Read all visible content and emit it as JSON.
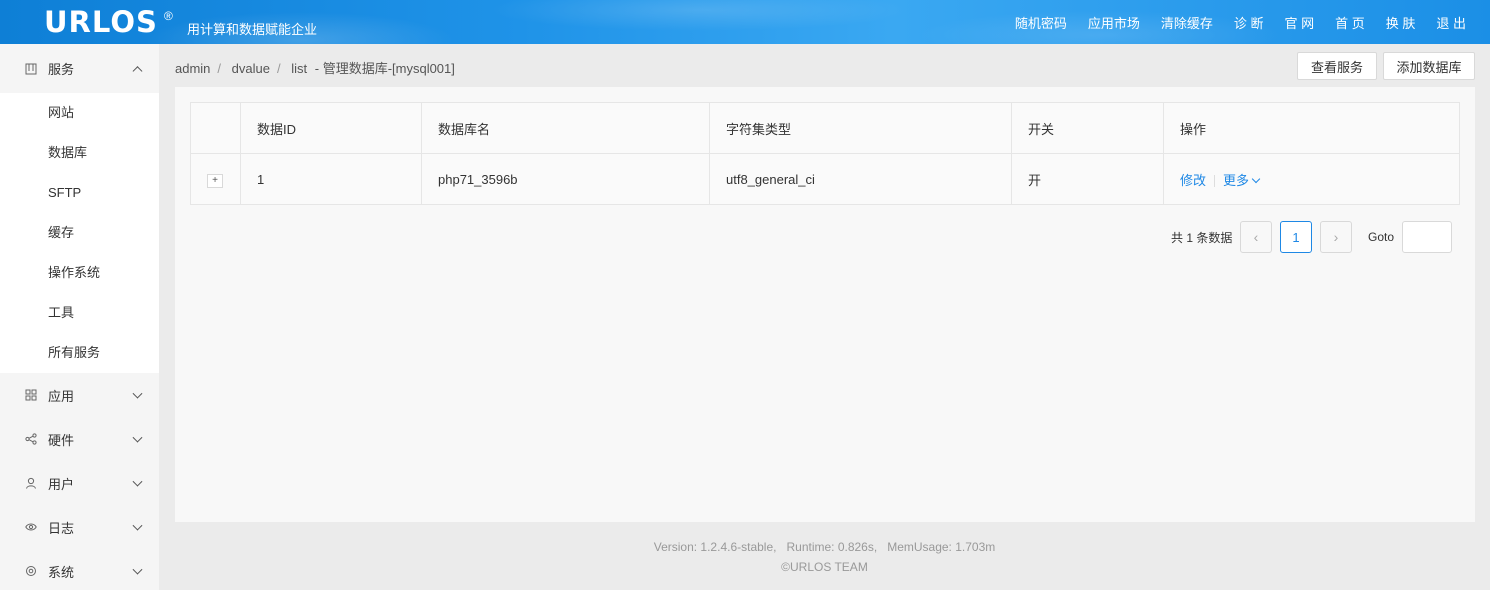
{
  "header": {
    "logo": "URLOS",
    "logo_mark": "®",
    "slogan": "用计算和数据赋能企业",
    "nav": [
      "随机密码",
      "应用市场",
      "清除缓存",
      "诊 断",
      "官 网",
      "首 页",
      "换 肤",
      "退 出"
    ]
  },
  "sidebar": {
    "service": {
      "label": "服务",
      "items": [
        "网站",
        "数据库",
        "SFTP",
        "缓存",
        "操作系统",
        "工具",
        "所有服务"
      ]
    },
    "groups": [
      {
        "label": "应用",
        "icon": "grid-icon"
      },
      {
        "label": "硬件",
        "icon": "share-icon"
      },
      {
        "label": "用户",
        "icon": "user-icon"
      },
      {
        "label": "日志",
        "icon": "eye-icon"
      },
      {
        "label": "系统",
        "icon": "gear-icon"
      }
    ]
  },
  "breadcrumb": {
    "items": [
      "admin",
      "dvalue",
      "list"
    ],
    "current": "- 管理数据库-[mysql001]"
  },
  "actions": {
    "view_services": "查看服务",
    "add_database": "添加数据库"
  },
  "table": {
    "columns": [
      "数据ID",
      "数据库名",
      "字符集类型",
      "开关",
      "操作"
    ],
    "rows": [
      {
        "expand": "+",
        "id": "1",
        "name": "php71_3596b",
        "charset": "utf8_general_ci",
        "switch": "开",
        "edit": "修改",
        "more": "更多"
      }
    ]
  },
  "pagination": {
    "total": "共 1 条数据",
    "current_page": "1",
    "goto_label": "Goto",
    "prev": "‹",
    "next": "›"
  },
  "footer": {
    "version": "Version: 1.2.4.6-stable,   Runtime: 0.826s,   MemUsage: 1.703m",
    "copyright": "©URLOS TEAM"
  },
  "colors": {
    "accent": "#1e88e5",
    "header": "#1f93e8"
  }
}
